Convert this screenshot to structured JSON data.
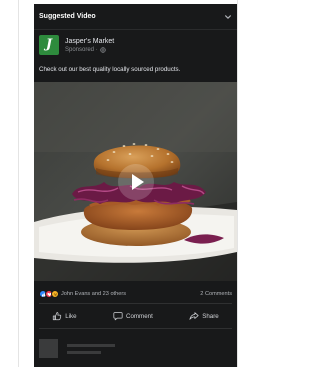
{
  "header": {
    "title": "Suggested Video",
    "menu_icon": "chevron-down-icon"
  },
  "post": {
    "page_name": "Jasper's Market",
    "logo_letter": "J",
    "sponsored_label": "Sponsored",
    "privacy_icon": "globe-icon",
    "caption": "Check out our best quality locally sourced products.",
    "media_icon": "play-icon"
  },
  "engagement": {
    "reactions": [
      "like-icon",
      "love-icon",
      "haha-icon"
    ],
    "reactions_text": "John Evans and 23 others",
    "comments_text": "2 Comments"
  },
  "actions": {
    "like_label": "Like",
    "comment_label": "Comment",
    "share_label": "Share"
  },
  "colors": {
    "card_background": "#18191a",
    "brand_green": "#2e8b3d",
    "like_blue": "#2d88ff",
    "love_red": "#f33e58",
    "haha_yellow": "#f7b125"
  }
}
